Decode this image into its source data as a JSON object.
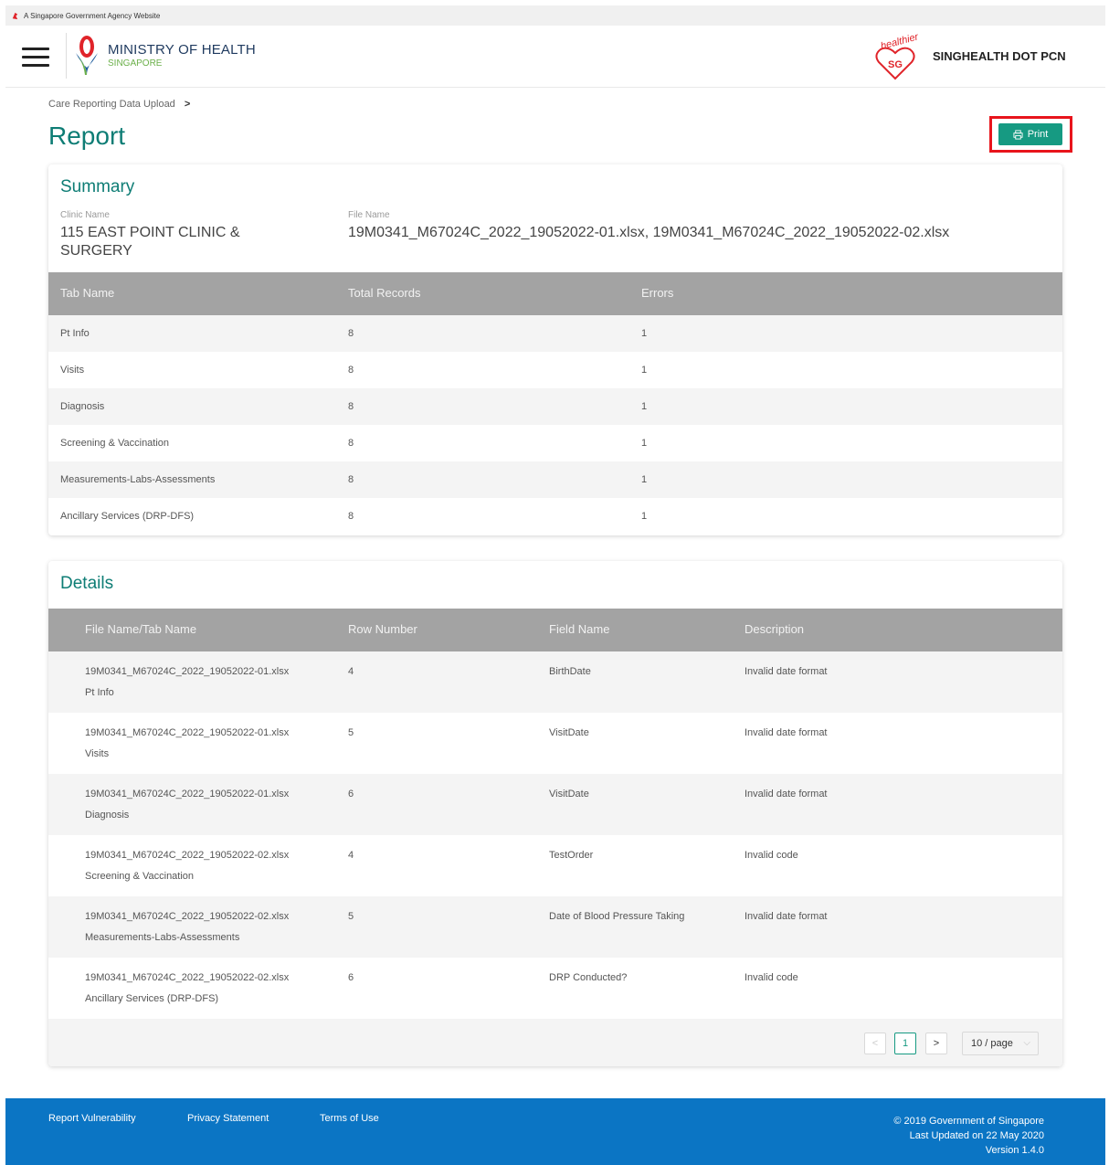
{
  "gov_bar": {
    "text": "A Singapore Government Agency Website"
  },
  "header": {
    "ministry": "MINISTRY OF HEALTH",
    "country": "SINGAPORE",
    "pcn_name": "SINGHEALTH DOT PCN",
    "logo_text_top": "healthier",
    "logo_text_badge": "SG"
  },
  "breadcrumb": {
    "item1": "Care Reporting Data Upload",
    "separator": ">"
  },
  "page": {
    "title": "Report",
    "print_label": "Print"
  },
  "summary": {
    "title": "Summary",
    "clinic_label": "Clinic Name",
    "clinic_value_line1": "115 EAST POINT CLINIC &",
    "clinic_value_line2": "SURGERY",
    "file_label": "File Name",
    "file_value": "19M0341_M67024C_2022_19052022-01.xlsx, 19M0341_M67024C_2022_19052022-02.xlsx",
    "columns": [
      "Tab Name",
      "Total Records",
      "Errors"
    ],
    "rows": [
      {
        "tab": "Pt Info",
        "total": "8",
        "errors": "1"
      },
      {
        "tab": "Visits",
        "total": "8",
        "errors": "1"
      },
      {
        "tab": "Diagnosis",
        "total": "8",
        "errors": "1"
      },
      {
        "tab": "Screening & Vaccination",
        "total": "8",
        "errors": "1"
      },
      {
        "tab": "Measurements-Labs-Assessments",
        "total": "8",
        "errors": "1"
      },
      {
        "tab": "Ancillary Services (DRP-DFS)",
        "total": "8",
        "errors": "1"
      }
    ]
  },
  "details": {
    "title": "Details",
    "columns": [
      "File Name/Tab Name",
      "Row Number",
      "Field Name",
      "Description"
    ],
    "rows": [
      {
        "file": "19M0341_M67024C_2022_19052022-01.xlsx",
        "tab": "Pt Info",
        "row": "4",
        "field": "BirthDate",
        "desc": "Invalid date format"
      },
      {
        "file": "19M0341_M67024C_2022_19052022-01.xlsx",
        "tab": "Visits",
        "row": "5",
        "field": "VisitDate",
        "desc": "Invalid date format"
      },
      {
        "file": "19M0341_M67024C_2022_19052022-01.xlsx",
        "tab": "Diagnosis",
        "row": "6",
        "field": "VisitDate",
        "desc": "Invalid date format"
      },
      {
        "file": "19M0341_M67024C_2022_19052022-02.xlsx",
        "tab": "Screening & Vaccination",
        "row": "4",
        "field": "TestOrder",
        "desc": "Invalid code"
      },
      {
        "file": "19M0341_M67024C_2022_19052022-02.xlsx",
        "tab": "Measurements-Labs-Assessments",
        "row": "5",
        "field": "Date of Blood Pressure Taking",
        "desc": "Invalid date format"
      },
      {
        "file": "19M0341_M67024C_2022_19052022-02.xlsx",
        "tab": "Ancillary Services (DRP-DFS)",
        "row": "6",
        "field": "DRP Conducted?",
        "desc": "Invalid code"
      }
    ],
    "pagination": {
      "prev": "<",
      "current": "1",
      "next": ">",
      "page_size": "10 / page"
    }
  },
  "footer": {
    "links": [
      "Report Vulnerability",
      "Privacy Statement",
      "Terms of Use"
    ],
    "copyright": "© 2019 Government of Singapore",
    "updated": "Last Updated on 22 May 2020",
    "version": "Version 1.4.0"
  },
  "colors": {
    "accent": "#0e7d75",
    "button": "#169a82",
    "footer": "#0b75c4",
    "highlight": "#e8141c"
  }
}
